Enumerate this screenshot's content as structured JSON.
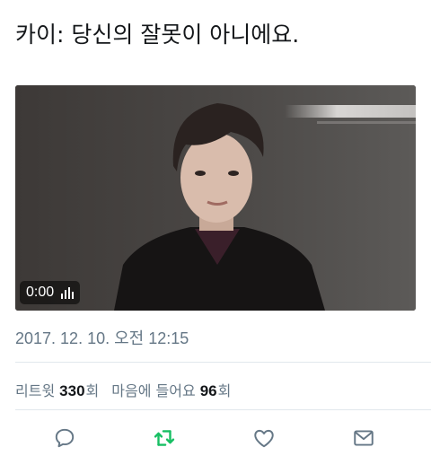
{
  "tweet": {
    "text": "카이: 당신의 잘못이 아니에요."
  },
  "video": {
    "time": "0:00",
    "icon": "volume-bars-icon"
  },
  "timestamp": "2017. 12. 10. 오전 12:15",
  "stats": {
    "retweets_label": "리트윗",
    "retweets_count": "330",
    "retweets_unit": "회",
    "likes_label": "마음에 들어요",
    "likes_count": "96",
    "likes_unit": "회"
  },
  "actions": [
    {
      "name": "reply",
      "icon": "speech-bubble-icon",
      "color": "#657786"
    },
    {
      "name": "retweet",
      "icon": "retweet-arrows-icon",
      "color": "#17bf63"
    },
    {
      "name": "like",
      "icon": "heart-icon",
      "color": "#657786"
    },
    {
      "name": "message",
      "icon": "envelope-icon",
      "color": "#657786"
    }
  ]
}
